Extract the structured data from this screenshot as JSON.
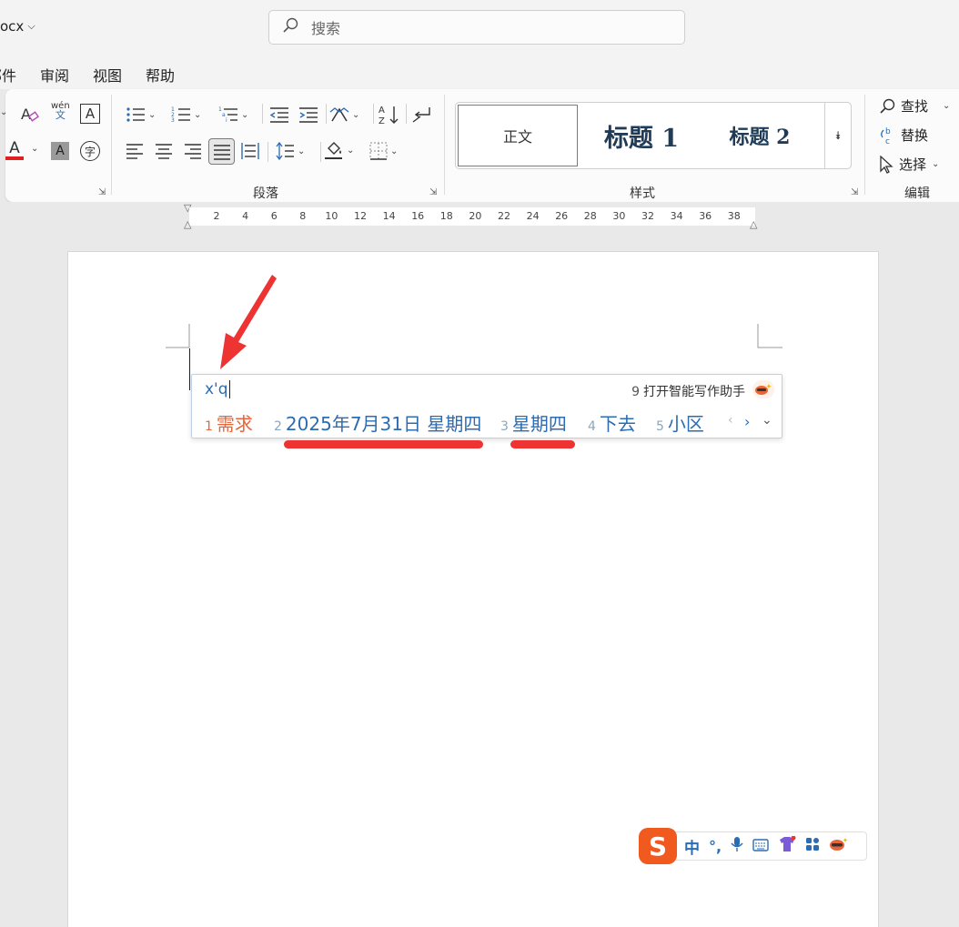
{
  "titlebar": {
    "doc_title": "ocx",
    "search_placeholder": "搜索"
  },
  "menu": {
    "items": [
      "部件",
      "审阅",
      "视图",
      "帮助"
    ]
  },
  "ribbon": {
    "groups": {
      "paragraph": "段落",
      "styles": "样式",
      "editing": "编辑"
    },
    "styles": [
      "正文",
      "标题 1",
      "标题 2"
    ],
    "editing": {
      "find": "查找",
      "replace": "替换",
      "select": "选择"
    },
    "font_icons": {
      "phonetic": "wén",
      "phonetic_sub": "文",
      "border_char": "A",
      "font_color": "A",
      "char_shading": "A",
      "enclose_char": "字"
    }
  },
  "ruler": {
    "ticks": [
      "2",
      "4",
      "6",
      "8",
      "10",
      "12",
      "14",
      "16",
      "18",
      "20",
      "22",
      "24",
      "26",
      "28",
      "30",
      "32",
      "34",
      "36",
      "38"
    ]
  },
  "ime": {
    "composition": "x'q",
    "ai_option_num": "9",
    "ai_option_label": "打开智能写作助手",
    "candidates": [
      {
        "num": "1",
        "text": "需求"
      },
      {
        "num": "2",
        "text": "2025年7月31日 星期四"
      },
      {
        "num": "3",
        "text": "星期四"
      },
      {
        "num": "4",
        "text": "下去"
      },
      {
        "num": "5",
        "text": "小区"
      }
    ],
    "status_bar": {
      "logo": "S",
      "mode": "中",
      "punct": "°,"
    }
  },
  "colors": {
    "accent_red": "#ee3333",
    "ime_blue": "#2b6cb3",
    "candidate_first": "#e8653a",
    "sogou_orange": "#f05a1e"
  }
}
